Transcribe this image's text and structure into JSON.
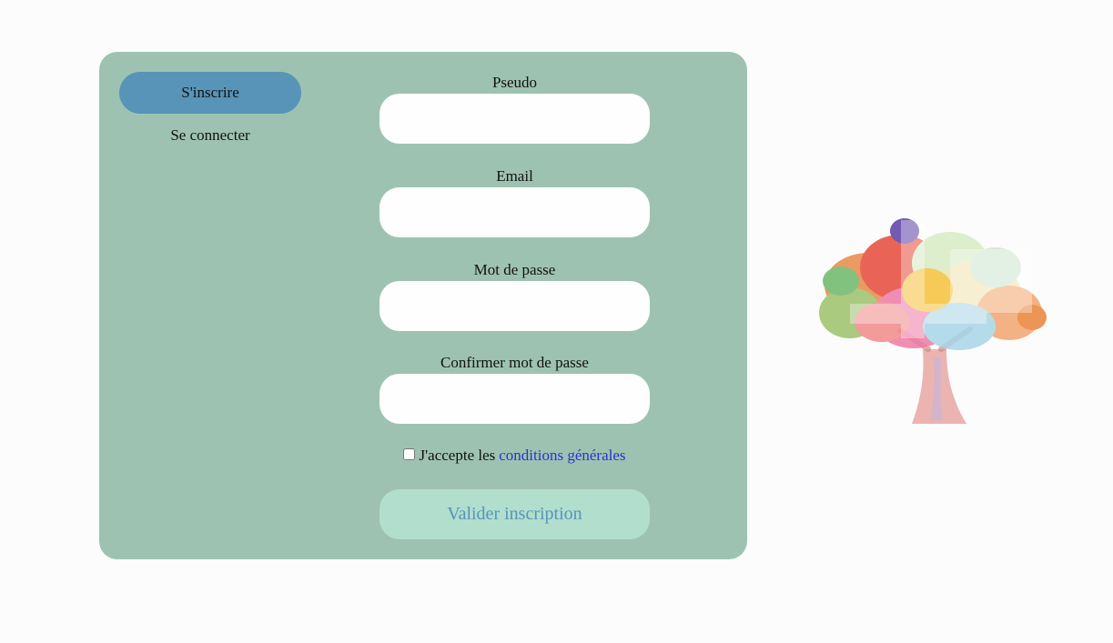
{
  "tabs": {
    "register_label": "S'inscrire",
    "login_label": "Se connecter"
  },
  "form": {
    "pseudo_label": "Pseudo",
    "email_label": "Email",
    "password_label": "Mot de passe",
    "confirm_password_label": "Confirmer mot de passe",
    "pseudo_value": "",
    "email_value": "",
    "password_value": "",
    "confirm_password_value": "",
    "terms_prefix": "J'accepte les",
    "terms_link": "conditions générales",
    "terms_checked": false,
    "submit_label": "Valider inscription"
  },
  "colors": {
    "page_background": "#fcfcfc",
    "panel": "#9ec2b1",
    "active_tab": "#5794b8",
    "submit_background": "#b2dece",
    "submit_text": "#5794b8",
    "link": "#2f2fd0"
  },
  "illustration": {
    "icon": "colorful-tree-icon"
  }
}
